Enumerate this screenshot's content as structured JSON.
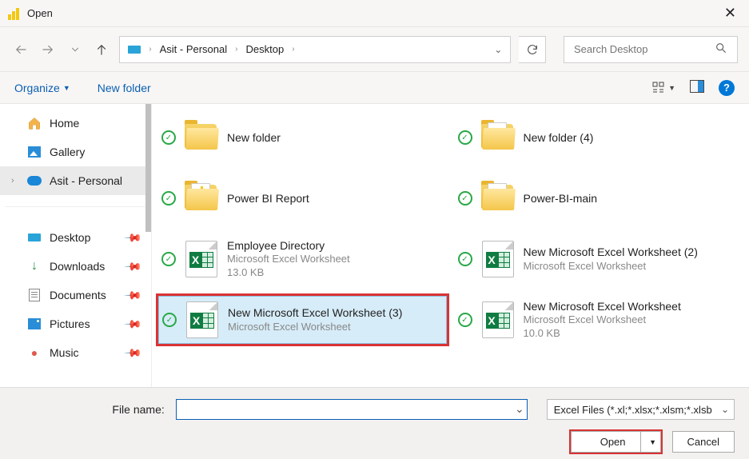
{
  "titlebar": {
    "title": "Open"
  },
  "breadcrumb": {
    "seg1": "Asit - Personal",
    "seg2": "Desktop"
  },
  "search": {
    "placeholder": "Search Desktop"
  },
  "toolbar": {
    "organize": "Organize",
    "newfolder": "New folder"
  },
  "sidebar": {
    "home": "Home",
    "gallery": "Gallery",
    "personal": "Asit - Personal",
    "desktop": "Desktop",
    "downloads": "Downloads",
    "documents": "Documents",
    "pictures": "Pictures",
    "music": "Music"
  },
  "files": {
    "f0": {
      "name": "New folder"
    },
    "f1": {
      "name": "New folder (4)"
    },
    "f2": {
      "name": "Power BI Report"
    },
    "f3": {
      "name": "Power-BI-main"
    },
    "f4": {
      "name": "Employee Directory",
      "type": "Microsoft Excel Worksheet",
      "size": "13.0 KB"
    },
    "f5": {
      "name": "New Microsoft Excel Worksheet (2)",
      "type": "Microsoft Excel Worksheet"
    },
    "f6": {
      "name": "New Microsoft Excel Worksheet (3)",
      "type": "Microsoft Excel Worksheet"
    },
    "f7": {
      "name": "New Microsoft Excel Worksheet",
      "type": "Microsoft Excel Worksheet",
      "size": "10.0 KB"
    }
  },
  "footer": {
    "filename_label": "File name:",
    "filename_value": "",
    "filetype": "Excel Files (*.xl;*.xlsx;*.xlsm;*.xlsb",
    "open": "Open",
    "cancel": "Cancel"
  }
}
